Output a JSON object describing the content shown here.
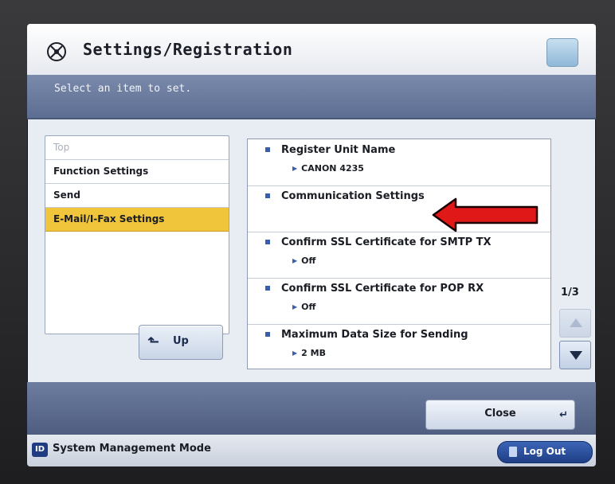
{
  "header": {
    "title": "Settings/Registration",
    "icon": "settings-gear-icon"
  },
  "instruction": "Select an item to set.",
  "breadcrumb": {
    "items": [
      {
        "label": "Top"
      },
      {
        "label": "Function Settings"
      },
      {
        "label": "Send"
      },
      {
        "label": "E-Mail/I-Fax Settings"
      }
    ],
    "up_label": "Up"
  },
  "settings": [
    {
      "label": "Register Unit Name",
      "value": "CANON 4235"
    },
    {
      "label": "Communication Settings",
      "value": ""
    },
    {
      "label": "Confirm SSL Certificate for SMTP TX",
      "value": "Off"
    },
    {
      "label": "Confirm SSL Certificate for POP RX",
      "value": "Off"
    },
    {
      "label": "Maximum Data Size for Sending",
      "value": "2 MB"
    }
  ],
  "pager": {
    "page": "1/3"
  },
  "close_label": "Close",
  "footer": {
    "id_badge": "ID",
    "mode": "System Management Mode",
    "logout": "Log Out"
  },
  "colors": {
    "highlight": "#f0c43b",
    "annotation_arrow": "#e01818",
    "logout_button": "#2a4c9c"
  }
}
